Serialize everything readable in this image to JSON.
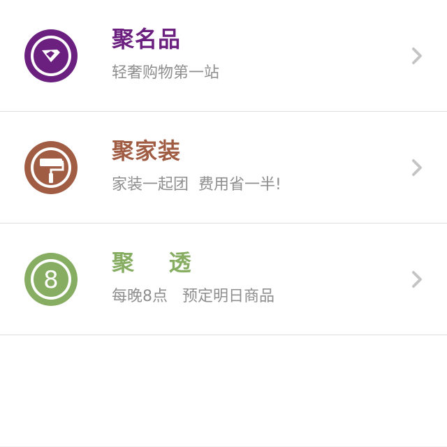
{
  "items": [
    {
      "title": "聚名品",
      "subtitle": "轻奢购物第一站",
      "icon": "diamond-icon",
      "color": "#6b2080"
    },
    {
      "title": "聚家装",
      "subtitle": "家装一起团  费用省一半!",
      "icon": "paint-roller-icon",
      "color": "#a15c44"
    },
    {
      "title": "聚    透",
      "subtitle": "每晚8点   预定明日商品",
      "icon": "number-8-icon",
      "icon_text": "8",
      "color": "#86ad62"
    }
  ],
  "chevron_color": "#c4c4c4",
  "divider_color": "#dddddd"
}
